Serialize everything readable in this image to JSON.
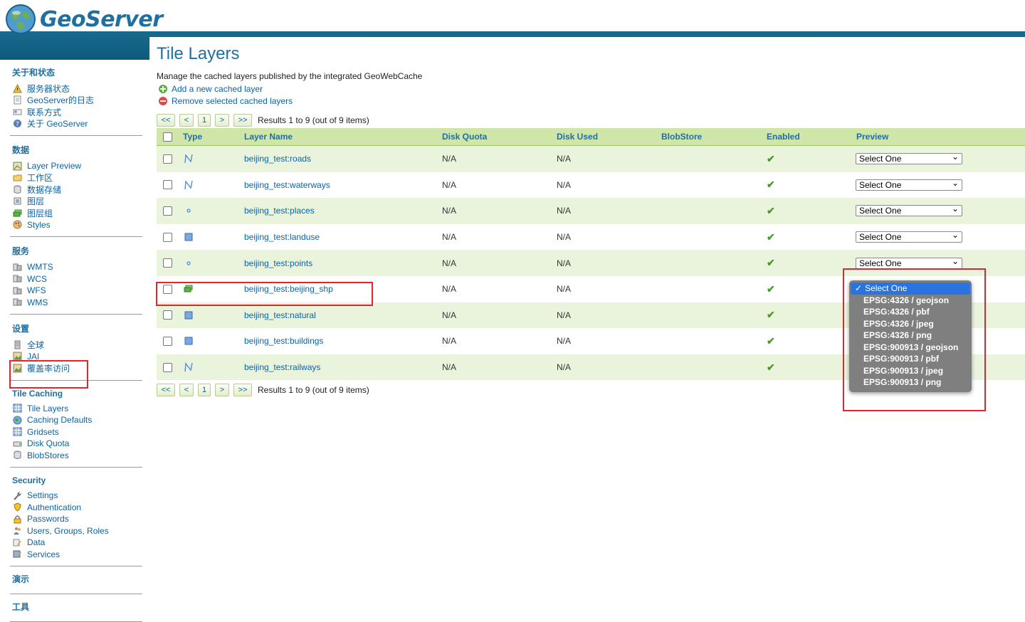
{
  "app": {
    "logo_text": "GeoServer"
  },
  "sidebar": {
    "sections": [
      {
        "title": "关于和状态",
        "items": [
          {
            "label": "服务器状态",
            "icon": "warning-icon"
          },
          {
            "label": "GeoServer的日志",
            "icon": "document-icon"
          },
          {
            "label": "联系方式",
            "icon": "contact-card-icon"
          },
          {
            "label": "关于 GeoServer",
            "icon": "help-icon"
          }
        ]
      },
      {
        "title": "数据",
        "items": [
          {
            "label": "Layer Preview",
            "icon": "map-preview-icon"
          },
          {
            "label": "工作区",
            "icon": "folder-icon"
          },
          {
            "label": "数据存储",
            "icon": "database-icon"
          },
          {
            "label": "图层",
            "icon": "layer-icon"
          },
          {
            "label": "图层组",
            "icon": "layer-group-icon"
          },
          {
            "label": "Styles",
            "icon": "palette-icon"
          }
        ]
      },
      {
        "title": "服务",
        "items": [
          {
            "label": "WMTS",
            "icon": "service-icon"
          },
          {
            "label": "WCS",
            "icon": "service-icon"
          },
          {
            "label": "WFS",
            "icon": "service-icon"
          },
          {
            "label": "WMS",
            "icon": "service-icon"
          }
        ]
      },
      {
        "title": "设置",
        "items": [
          {
            "label": "全球",
            "icon": "server-icon"
          },
          {
            "label": "JAI",
            "icon": "image-icon"
          },
          {
            "label": "覆盖率访问",
            "icon": "image-icon"
          }
        ]
      },
      {
        "title": "Tile Caching",
        "items": [
          {
            "label": "Tile Layers",
            "icon": "grid-icon"
          },
          {
            "label": "Caching Defaults",
            "icon": "globe-icon"
          },
          {
            "label": "Gridsets",
            "icon": "grid-icon"
          },
          {
            "label": "Disk Quota",
            "icon": "disk-icon"
          },
          {
            "label": "BlobStores",
            "icon": "database-icon"
          }
        ]
      },
      {
        "title": "Security",
        "items": [
          {
            "label": "Settings",
            "icon": "wrench-icon"
          },
          {
            "label": "Authentication",
            "icon": "shield-icon"
          },
          {
            "label": "Passwords",
            "icon": "lock-icon"
          },
          {
            "label": "Users, Groups, Roles",
            "icon": "users-icon"
          },
          {
            "label": "Data",
            "icon": "data-edit-icon"
          },
          {
            "label": "Services",
            "icon": "services-edit-icon"
          }
        ]
      },
      {
        "title": "演示",
        "items": []
      },
      {
        "title": "工具",
        "items": []
      }
    ]
  },
  "main": {
    "title": "Tile Layers",
    "description": "Manage the cached layers published by the integrated GeoWebCache",
    "add_label": "Add a new cached layer",
    "remove_label": "Remove selected cached layers",
    "pager": {
      "first": "<<",
      "prev": "<",
      "page": "1",
      "next": ">",
      "last": ">>",
      "result_text": "Results 1 to 9 (out of 9 items)"
    },
    "columns": [
      "Type",
      "Layer Name",
      "Disk Quota",
      "Disk Used",
      "BlobStore",
      "Enabled",
      "Preview"
    ],
    "rows": [
      {
        "type": "line-icon",
        "name": "beijing_test:roads",
        "quota": "N/A",
        "used": "N/A",
        "blobstore": "",
        "enabled": "✔",
        "preview": "Select One"
      },
      {
        "type": "line-icon",
        "name": "beijing_test:waterways",
        "quota": "N/A",
        "used": "N/A",
        "blobstore": "",
        "enabled": "✔",
        "preview": "Select One"
      },
      {
        "type": "point-icon",
        "name": "beijing_test:places",
        "quota": "N/A",
        "used": "N/A",
        "blobstore": "",
        "enabled": "✔",
        "preview": "Select One"
      },
      {
        "type": "polygon-icon",
        "name": "beijing_test:landuse",
        "quota": "N/A",
        "used": "N/A",
        "blobstore": "",
        "enabled": "✔",
        "preview": "Select One"
      },
      {
        "type": "point-icon",
        "name": "beijing_test:points",
        "quota": "N/A",
        "used": "N/A",
        "blobstore": "",
        "enabled": "✔",
        "preview": "Select One"
      },
      {
        "type": "layer-group-icon",
        "name": "beijing_test:beijing_shp",
        "quota": "N/A",
        "used": "N/A",
        "blobstore": "",
        "enabled": "✔",
        "preview": ""
      },
      {
        "type": "polygon-icon",
        "name": "beijing_test:natural",
        "quota": "N/A",
        "used": "N/A",
        "blobstore": "",
        "enabled": "✔",
        "preview": ""
      },
      {
        "type": "polygon-icon",
        "name": "beijing_test:buildings",
        "quota": "N/A",
        "used": "N/A",
        "blobstore": "",
        "enabled": "✔",
        "preview": ""
      },
      {
        "type": "line-icon",
        "name": "beijing_test:railways",
        "quota": "N/A",
        "used": "N/A",
        "blobstore": "",
        "enabled": "✔",
        "preview": ""
      }
    ]
  },
  "preview_dropdown": {
    "options": [
      "Select One",
      "EPSG:4326 / geojson",
      "EPSG:4326 / pbf",
      "EPSG:4326 / jpeg",
      "EPSG:4326 / png",
      "EPSG:900913 / geojson",
      "EPSG:900913 / pbf",
      "EPSG:900913 / jpeg",
      "EPSG:900913 / png"
    ],
    "selected_mark": "✓"
  },
  "colors": {
    "accent": "#1f6fa0",
    "header_band": "#0c5a7c",
    "table_header": "#cfe6a8",
    "row_alt": "#eaf4dd",
    "annotation": "#e0262b"
  }
}
